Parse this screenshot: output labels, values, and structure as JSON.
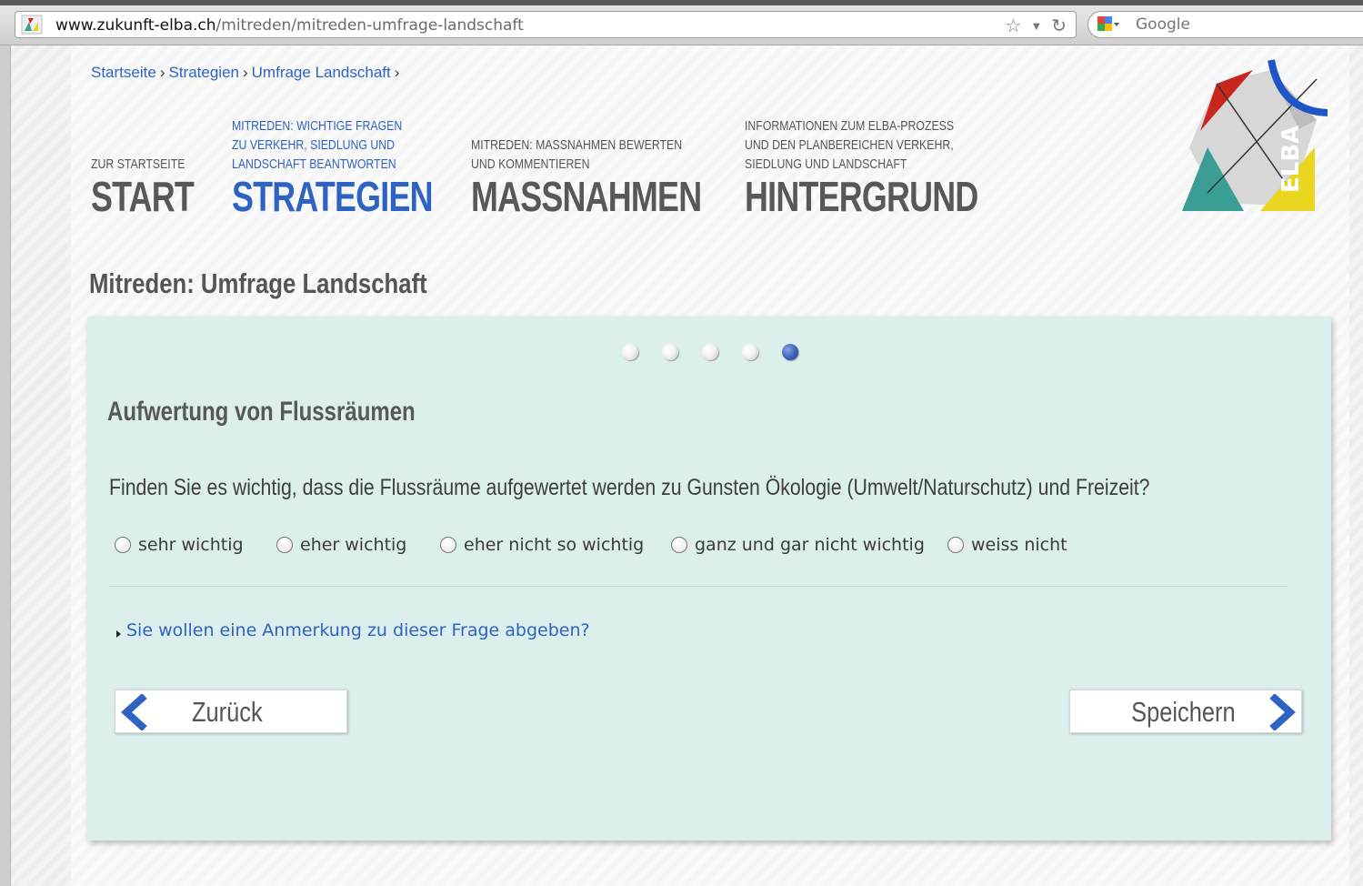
{
  "browser": {
    "url_host": "www.zukunft-elba.ch",
    "url_path": "/mitreden/mitreden-umfrage-landschaft",
    "search_placeholder": "Google"
  },
  "breadcrumb": [
    {
      "label": "Startseite"
    },
    {
      "label": "Strategien"
    },
    {
      "label": "Umfrage Landschaft"
    }
  ],
  "breadcrumb_separator": "›",
  "nav": [
    {
      "sub": "ZUR STARTSEITE",
      "main": "START",
      "active": false
    },
    {
      "sub": "MITREDEN: WICHTIGE FRAGEN\nZU VERKEHR, SIEDLUNG UND\nLANDSCHAFT BEANTWORTEN",
      "main": "STRATEGIEN",
      "active": true
    },
    {
      "sub": "MITREDEN: MASSNAHMEN BEWERTEN\nUND KOMMENTIEREN",
      "main": "MASSNAHMEN",
      "active": false
    },
    {
      "sub": "INFORMATIONEN ZUM ELBA-PROZESS\nUND DEN PLANBEREICHEN VERKEHR,\nSIEDLUNG UND LANDSCHAFT",
      "main": "HINTERGRUND",
      "active": false
    }
  ],
  "logo_text": "ELBA",
  "page_title": "Mitreden: Umfrage Landschaft",
  "survey": {
    "steps_total": 5,
    "current_step": 5,
    "question_title": "Aufwertung von Flussräumen",
    "question_text": "Finden Sie es wichtig, dass die Flussräume aufgewertet werden zu Gunsten Ökologie (Umwelt/Naturschutz) und Freizeit?",
    "options": [
      "sehr wichtig",
      "eher wichtig",
      "eher nicht so wichtig",
      "ganz und gar nicht wichtig",
      "weiss nicht"
    ],
    "comment_link": "Sie wollen eine Anmerkung zu dieser Frage abgeben?",
    "back_label": "Zurück",
    "save_label": "Speichern"
  },
  "colors": {
    "accent_blue": "#2e63c4",
    "panel_bg": "#dcefec",
    "nav_gray": "#585858",
    "logo_red": "#c8261e",
    "logo_teal": "#3a9e95",
    "logo_yellow": "#e8d620",
    "logo_blue": "#1f56c7"
  },
  "icons": [
    "favicon-icon",
    "bookmark-star-icon",
    "dropdown-arrow-icon",
    "reload-icon",
    "google-search-icon",
    "chevron-left-icon",
    "chevron-right-icon",
    "disclosure-arrow-icon"
  ]
}
